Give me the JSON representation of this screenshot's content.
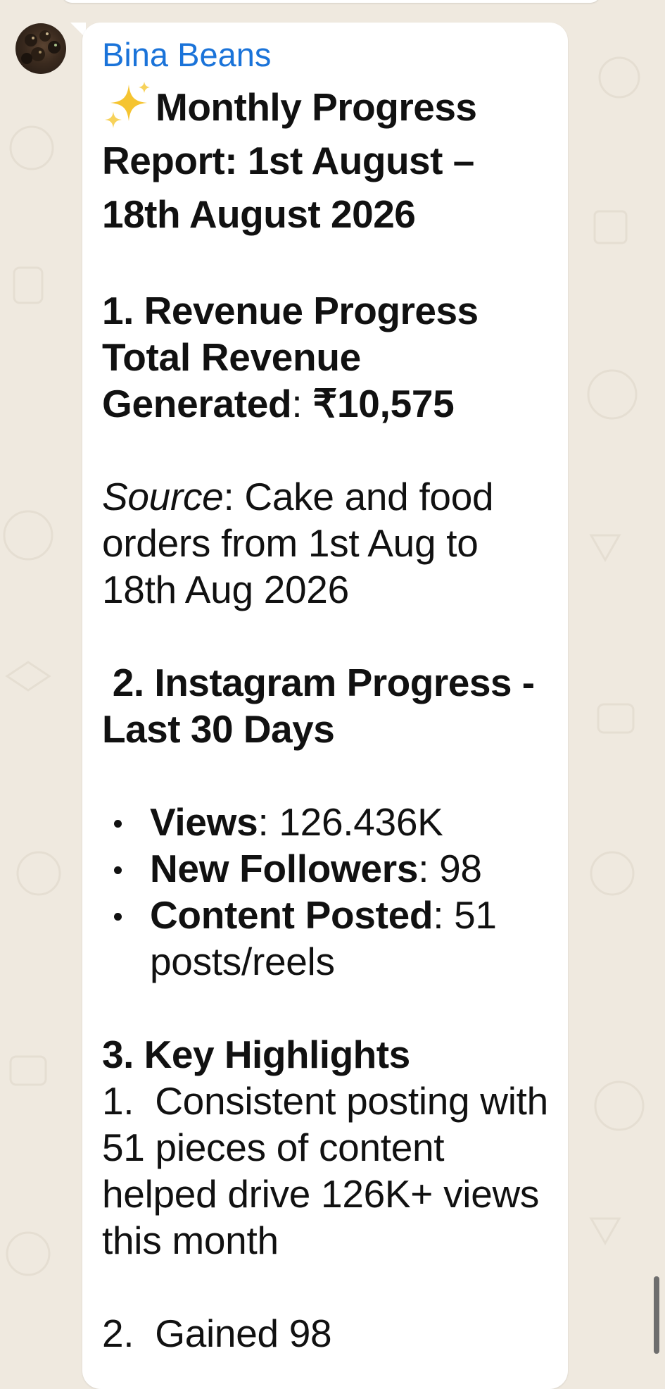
{
  "chat": {
    "sender_name": "Bina Beans",
    "title_emoji": "sparkles-icon",
    "title": "Monthly Progress Report: 1st August – 18th August 2026",
    "section1": {
      "heading": "1. Revenue Progress",
      "total_label": "Total Revenue Generated",
      "total_sep": ": ",
      "total_value": "₹10,575",
      "source_label": "Source",
      "source_text": ": Cake and food orders from 1st Aug to 18th Aug 2026"
    },
    "section2": {
      "heading": " 2. Instagram Progress - Last 30 Days",
      "bullets": [
        {
          "label": "Views",
          "value": ": 126.436K"
        },
        {
          "label": "New Followers",
          "value": ": 98"
        },
        {
          "label": "Content Posted",
          "value": ": 51 posts/reels"
        }
      ]
    },
    "section3": {
      "heading": "3. Key Highlights",
      "item1": "1.  Consistent posting with 51 pieces of content helped drive 126K+ views this month",
      "item2_partial": "2.  Gained 98"
    }
  },
  "colors": {
    "sender": "#1a73d9",
    "wallpaper": "#efe9df",
    "bubble": "#ffffff"
  }
}
